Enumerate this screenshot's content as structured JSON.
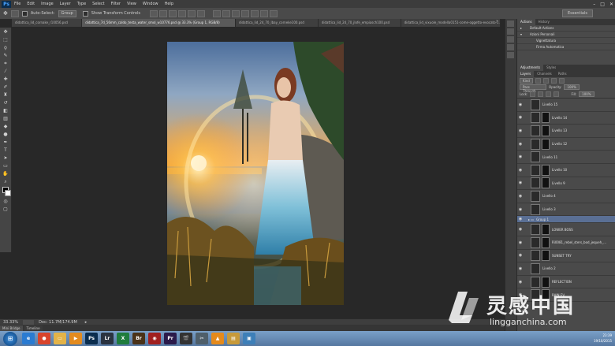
{
  "menubar": {
    "logo": "Ps",
    "items": [
      "File",
      "Edit",
      "Image",
      "Layer",
      "Type",
      "Select",
      "Filter",
      "View",
      "Window",
      "Help"
    ]
  },
  "options": {
    "auto_select_label": "Auto-Select:",
    "auto_select_value": "Group",
    "transform_label": "Show Transform Controls",
    "workspace": "Essentials"
  },
  "tabs": [
    {
      "label": "didattica_lid_cornake_r10056.psd",
      "active": false
    },
    {
      "label": "didattica_7d_56mm_caldo_testa_water_smol_w10776.psd @ 33.3% (Group 1, RGB/8)",
      "active": true
    },
    {
      "label": "didattica_lid_24_70_lbay_corneke100.psd",
      "active": false
    },
    {
      "label": "didattica_lid_24_70_jlofe_empiasch100.psd",
      "active": false
    },
    {
      "label": "didattica_lid_vixuole_modella0151-come-oggetto-evocato-1.p",
      "active": false
    }
  ],
  "status": {
    "zoom": "33.33%",
    "doc": "Doc: 11.7M/174.9M"
  },
  "bridge_tabs": [
    "Mini Bridge",
    "Timeline"
  ],
  "actions_panel": {
    "tabs": [
      "Actions",
      "History"
    ],
    "rows": [
      "Default Actions",
      "Azioni Personali",
      "Vignettatura",
      "Firma Automatica"
    ]
  },
  "adjust_panel": {
    "tabs": [
      "Adjustments",
      "Styles"
    ]
  },
  "layers_panel": {
    "tabs": [
      "Layers",
      "Channels",
      "Paths"
    ],
    "kind_label": "Kind",
    "blend_mode": "Pass Through",
    "opacity_label": "Opacity:",
    "opacity_value": "100%",
    "lock_label": "Lock:",
    "fill_label": "Fill:",
    "fill_value": "100%",
    "layers": [
      {
        "name": "Livello 15",
        "mask": false,
        "group": false
      },
      {
        "name": "Livello 14",
        "mask": true,
        "group": false
      },
      {
        "name": "Livello 13",
        "mask": true,
        "group": false
      },
      {
        "name": "Livello 12",
        "mask": true,
        "group": false
      },
      {
        "name": "Livello 11",
        "mask": false,
        "group": false
      },
      {
        "name": "Livello 10",
        "mask": true,
        "group": false
      },
      {
        "name": "Livello 9",
        "mask": true,
        "group": false
      },
      {
        "name": "Livello 4",
        "mask": false,
        "group": false
      },
      {
        "name": "Livello 3",
        "mask": false,
        "group": false
      },
      {
        "name": "Group 1",
        "mask": false,
        "group": true
      },
      {
        "name": "LOWER BOSS",
        "mask": true,
        "group": false
      },
      {
        "name": "Ri0081_rebel_sters_bod_jequeh_...",
        "mask": true,
        "group": false
      },
      {
        "name": "SUNSET TRY",
        "mask": true,
        "group": false
      },
      {
        "name": "Livello 2",
        "mask": false,
        "group": false
      },
      {
        "name": "REFLECTION",
        "mask": true,
        "group": false
      },
      {
        "name": "RAIN EV",
        "mask": true,
        "group": false
      }
    ]
  },
  "taskbar": {
    "apps": [
      {
        "name": "internet-explorer-icon",
        "glyph": "e",
        "color": "#2a7bd1"
      },
      {
        "name": "chrome-icon",
        "glyph": "●",
        "color": "#d8442c"
      },
      {
        "name": "explorer-icon",
        "glyph": "▭",
        "color": "#e3b348"
      },
      {
        "name": "media-player-icon",
        "glyph": "▶",
        "color": "#e38b1f"
      },
      {
        "name": "photoshop-icon",
        "glyph": "Ps",
        "color": "#0b2d4e"
      },
      {
        "name": "lightroom-icon",
        "glyph": "Lr",
        "color": "#2a3340"
      },
      {
        "name": "excel-icon",
        "glyph": "X",
        "color": "#1f7c3d"
      },
      {
        "name": "bridge-icon",
        "glyph": "Br",
        "color": "#4a3218"
      },
      {
        "name": "record-icon",
        "glyph": "◉",
        "color": "#a02020"
      },
      {
        "name": "premiere-icon",
        "glyph": "Pr",
        "color": "#2b1a4a"
      },
      {
        "name": "clapper-icon",
        "glyph": "🎬",
        "color": "#333333"
      },
      {
        "name": "snip-icon",
        "glyph": "✂",
        "color": "#4f5f6a"
      },
      {
        "name": "vlc-icon",
        "glyph": "▲",
        "color": "#e48a1c"
      },
      {
        "name": "folder-icon",
        "glyph": "▤",
        "color": "#c79a3a"
      },
      {
        "name": "photo-viewer-icon",
        "glyph": "▣",
        "color": "#3d7fb8"
      }
    ],
    "time": "23:39",
    "date": "19/10/2015"
  },
  "watermark": {
    "brand": "灵感中国",
    "url": "lingganchina.com"
  },
  "colors": {
    "brand_blue": "#2a7bd1",
    "selected_layer": "#5a6f94"
  }
}
